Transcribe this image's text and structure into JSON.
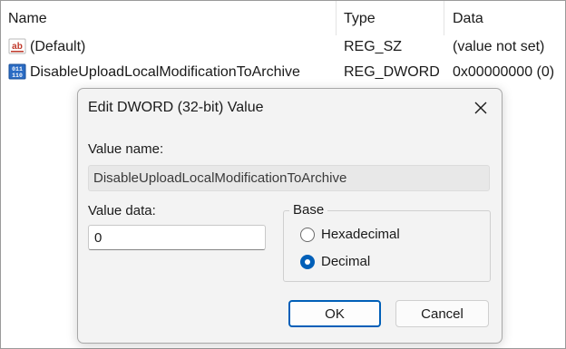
{
  "list": {
    "columns": {
      "name": "Name",
      "type": "Type",
      "data": "Data"
    },
    "rows": [
      {
        "icon": "string-value-icon",
        "name": "(Default)",
        "type": "REG_SZ",
        "data": "(value not set)"
      },
      {
        "icon": "binary-value-icon",
        "name": "DisableUploadLocalModificationToArchive",
        "type": "REG_DWORD",
        "data": "0x00000000 (0)"
      }
    ]
  },
  "dialog": {
    "title": "Edit DWORD (32-bit) Value",
    "value_name_label": "Value name:",
    "value_name": "DisableUploadLocalModificationToArchive",
    "value_data_label": "Value data:",
    "value_data": "0",
    "base_label": "Base",
    "base_options": [
      {
        "label": "Hexadecimal",
        "selected": false
      },
      {
        "label": "Decimal",
        "selected": true
      }
    ],
    "ok_label": "OK",
    "cancel_label": "Cancel"
  },
  "colors": {
    "accent": "#005fb8",
    "dialog_bg": "#f3f3f3"
  }
}
